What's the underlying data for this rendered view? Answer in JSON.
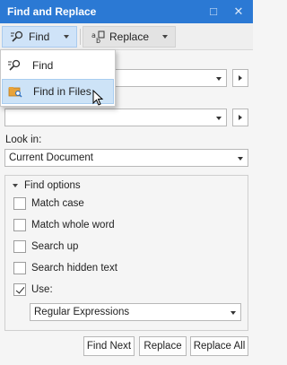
{
  "window": {
    "title": "Find and Replace"
  },
  "toolbar": {
    "find_label": "Find",
    "replace_label": "Replace"
  },
  "find_menu": {
    "items": [
      {
        "label": "Find"
      },
      {
        "label": "Find in Files"
      }
    ]
  },
  "find_what": {
    "value": ""
  },
  "replace_with": {
    "value": ""
  },
  "look_in": {
    "label": "Look in:",
    "value": "Current Document"
  },
  "find_options": {
    "title": "Find options",
    "match_case": {
      "label": "Match case",
      "checked": false
    },
    "match_whole_word": {
      "label": "Match whole word",
      "checked": false
    },
    "search_up": {
      "label": "Search up",
      "checked": false
    },
    "search_hidden_text": {
      "label": "Search hidden text",
      "checked": false
    },
    "use": {
      "label": "Use:",
      "checked": true,
      "value": "Regular Expressions"
    }
  },
  "actions": {
    "find_next": "Find Next",
    "replace": "Replace",
    "replace_all": "Replace All"
  },
  "colors": {
    "title_bar": "#2b79d4",
    "menu_highlight": "#cde3f7"
  }
}
